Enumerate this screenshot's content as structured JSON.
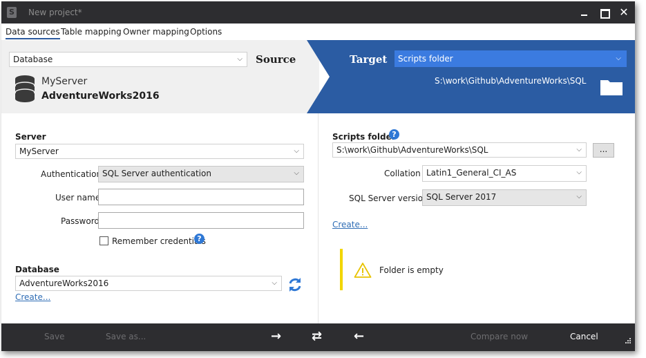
{
  "window": {
    "title": "New project*",
    "controls": {
      "minimize": "—",
      "maximize": "☐",
      "close": "✕"
    }
  },
  "tabs": [
    "Data sources",
    "Table mapping",
    "Owner mapping",
    "Options"
  ],
  "source": {
    "type_select": "Database",
    "label": "Source",
    "server": "MyServer",
    "database": "AdventureWorks2016"
  },
  "target": {
    "label": "Target",
    "type_select": "Scripts folder",
    "path": "S:\\work\\Github\\AdventureWorks\\SQL"
  },
  "left_form": {
    "server_label": "Server",
    "server_value": "MyServer",
    "auth_label": "Authentication",
    "auth_value": "SQL Server authentication",
    "username_label": "User name",
    "username_value": "",
    "password_label": "Password",
    "password_value": "",
    "remember_label": "Remember credentials",
    "database_label": "Database",
    "database_value": "AdventureWorks2016",
    "create_link": "Create..."
  },
  "right_form": {
    "scripts_folder_label": "Scripts folder",
    "scripts_folder_value": "S:\\work\\Github\\AdventureWorks\\SQL",
    "browse_label": "...",
    "collation_label": "Collation",
    "collation_value": "Latin1_General_CI_AS",
    "version_label": "SQL Server version",
    "version_value": "SQL Server 2017",
    "create_link": "Create...",
    "notice_text": "Folder is empty"
  },
  "footer": {
    "save": "Save",
    "save_as": "Save as...",
    "compare_now": "Compare now",
    "cancel": "Cancel",
    "arrow_right": "→",
    "swap": "⇄",
    "arrow_left": "←"
  },
  "colors": {
    "titlebar": "#2d2d30",
    "target_panel": "#2b5ca3",
    "target_select": "#3b7be0",
    "link": "#2f6db5",
    "notice_bar": "#f2d600"
  }
}
